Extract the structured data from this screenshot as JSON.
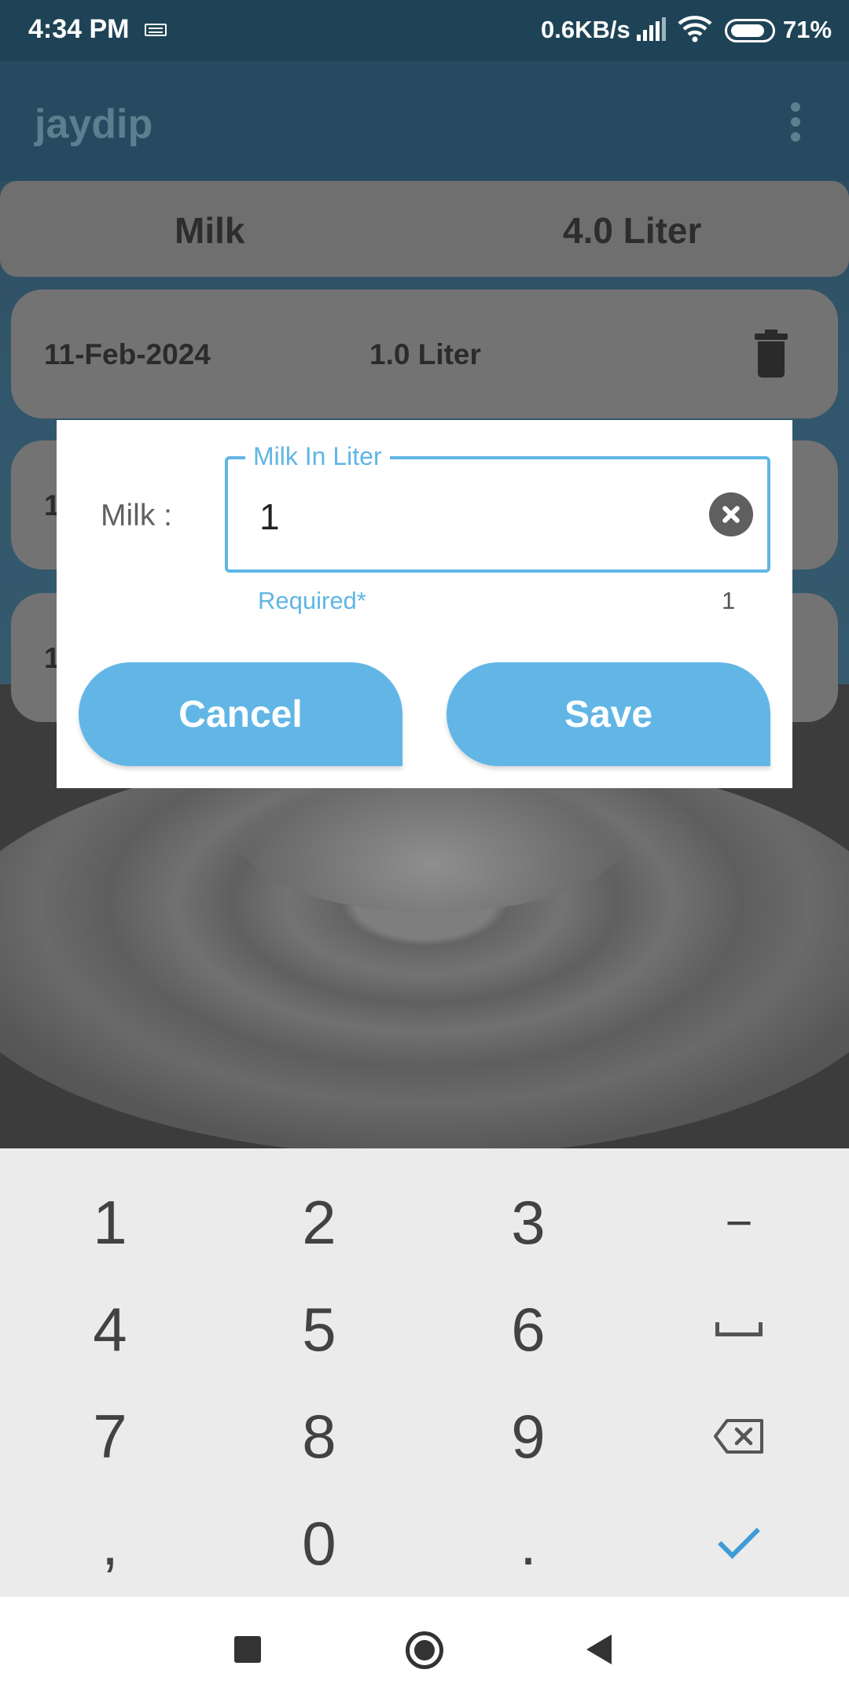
{
  "status_bar": {
    "time": "4:34 PM",
    "net_speed": "0.6KB/s",
    "battery_pct": "71%"
  },
  "app_bar": {
    "title": "jaydip",
    "overflow_icon": "more-vert-icon"
  },
  "summary": {
    "label": "Milk",
    "total": "4.0 Liter"
  },
  "entries": [
    {
      "date": "11-Feb-2024",
      "qty": "1.0 Liter",
      "icon": "delete-icon"
    },
    {
      "date_peek": "1"
    },
    {
      "date_peek": "1"
    }
  ],
  "dialog": {
    "label": "Milk :",
    "field_legend": "Milk In Liter",
    "field_value": "1",
    "helper_text": "Required*",
    "char_counter": "1",
    "cancel_label": "Cancel",
    "save_label": "Save",
    "accent_color": "#5fb6e5"
  },
  "keyboard": {
    "keys": [
      "1",
      "2",
      "3",
      "−",
      "4",
      "5",
      "6",
      "space",
      "7",
      "8",
      "9",
      "backspace",
      ",",
      "0",
      ".",
      "done"
    ]
  },
  "nav_bar": {
    "icons": [
      "recents-icon",
      "home-icon",
      "back-icon"
    ]
  }
}
